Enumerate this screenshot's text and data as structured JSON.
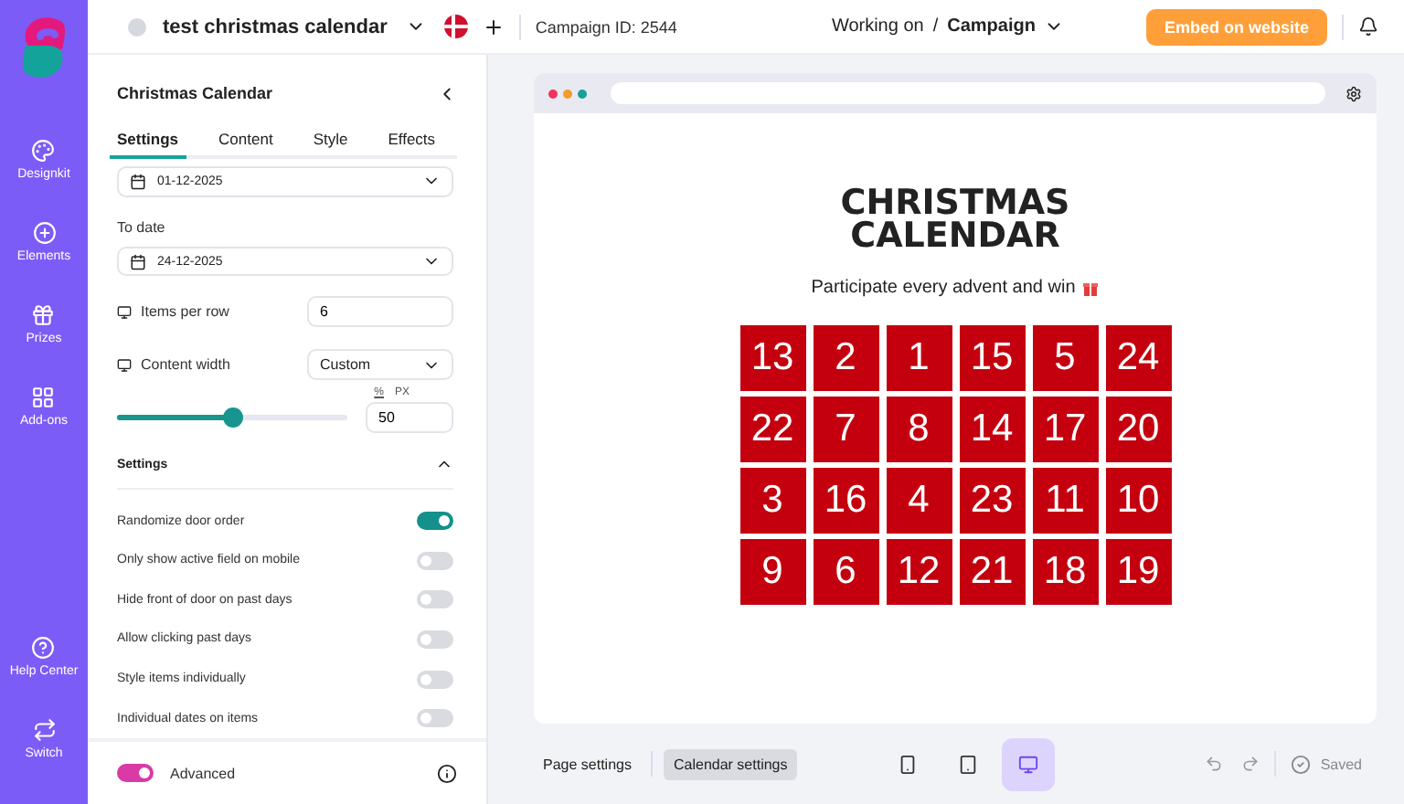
{
  "rail": {
    "top": [
      {
        "label": "Designkit",
        "selected": false
      },
      {
        "label": "Elements",
        "selected": false
      },
      {
        "label": "Prizes",
        "selected": false
      },
      {
        "label": "Add-ons",
        "selected": false
      }
    ],
    "bottom": [
      {
        "label": "Help Center"
      },
      {
        "label": "Switch"
      }
    ]
  },
  "topbar": {
    "campaign_name": "test christmas calendar",
    "campaign_id": "Campaign ID: 2544",
    "working_on": "Working on",
    "separator": "/",
    "context": "Campaign",
    "embed_button": "Embed on website"
  },
  "panel": {
    "title": "Christmas Calendar",
    "tabs": [
      {
        "label": "Settings",
        "selected": true
      },
      {
        "label": "Content",
        "selected": false
      },
      {
        "label": "Style",
        "selected": false
      },
      {
        "label": "Effects",
        "selected": false
      }
    ],
    "from_date": "01-12-2025",
    "to_date_label": "To date",
    "to_date": "24-12-2025",
    "items_per_row": {
      "label": "Items per row",
      "value": "6"
    },
    "content_width": {
      "label": "Content width",
      "value": "Custom"
    },
    "units": [
      {
        "label": "%",
        "selected": true
      },
      {
        "label": "PX",
        "selected": false
      }
    ],
    "width_slider": {
      "level": 0.5,
      "value": "50"
    },
    "section": {
      "title": "Settings",
      "expanded": true
    },
    "toggles": [
      {
        "label": "Randomize door order",
        "on": true
      },
      {
        "label": "Only show active field on mobile",
        "on": false
      },
      {
        "label": "Hide front of door on past days",
        "on": false
      },
      {
        "label": "Allow clicking past days",
        "on": false
      },
      {
        "label": "Style items individually",
        "on": false
      },
      {
        "label": "Individual dates on items",
        "on": false
      }
    ],
    "advanced": {
      "label": "Advanced",
      "on": true
    }
  },
  "preview": {
    "title": "CHRISTMAS CALENDAR",
    "subtitle": "Participate every advent and win",
    "doors": [
      "13",
      "2",
      "1",
      "15",
      "5",
      "24",
      "22",
      "7",
      "8",
      "14",
      "17",
      "20",
      "3",
      "16",
      "4",
      "23",
      "11",
      "10",
      "9",
      "6",
      "12",
      "21",
      "18",
      "19"
    ]
  },
  "bottombar": {
    "page_settings": {
      "label": "Page settings",
      "selected": false
    },
    "calendar_settings": {
      "label": "Calendar settings",
      "selected": true
    },
    "devices": [
      {
        "kind": "mobile",
        "selected": false
      },
      {
        "kind": "tablet",
        "selected": false
      },
      {
        "kind": "desktop",
        "selected": true
      }
    ],
    "status": "Saved"
  }
}
